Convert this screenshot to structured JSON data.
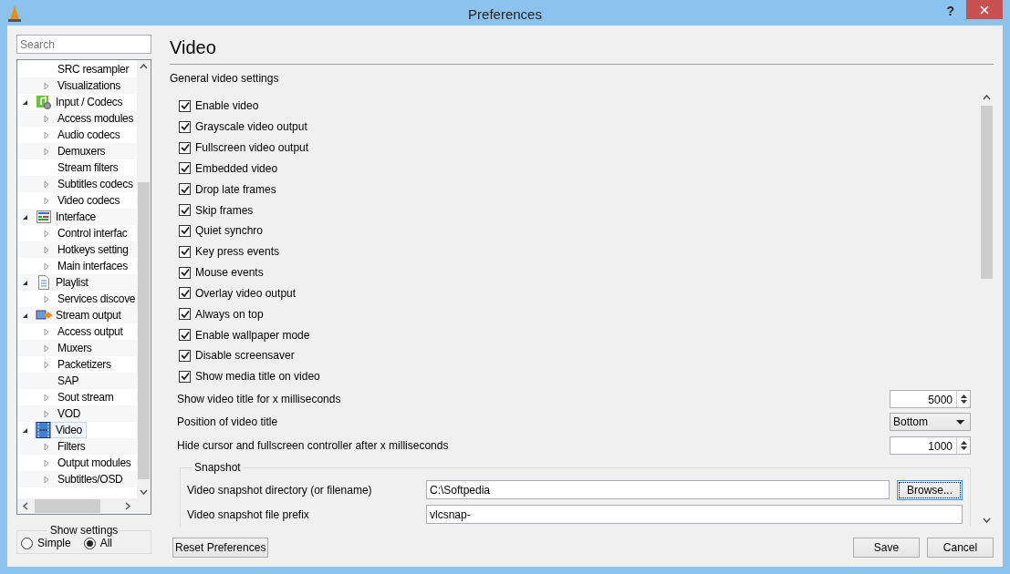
{
  "window": {
    "title": "Preferences",
    "help": "?"
  },
  "search": {
    "placeholder": "Search"
  },
  "tree": [
    {
      "children": [
        {
          "label": "SRC resampler",
          "selected": false
        },
        {
          "label": "Visualizations",
          "selected": false,
          "expanded": false
        }
      ]
    },
    {
      "label": "Input / Codecs",
      "kind": "codecs",
      "selected": false,
      "expanded": true,
      "children": [
        {
          "label": "Access modules",
          "selected": false,
          "expanded": false
        },
        {
          "label": "Audio codecs",
          "selected": false,
          "expanded": false
        },
        {
          "label": "Demuxers",
          "selected": false,
          "expanded": false
        },
        {
          "label": "Stream filters",
          "selected": false
        },
        {
          "label": "Subtitles codecs",
          "selected": false,
          "expanded": false
        },
        {
          "label": "Video codecs",
          "selected": false,
          "expanded": false
        }
      ]
    },
    {
      "label": "Interface",
      "kind": "interface",
      "selected": false,
      "expanded": true,
      "children": [
        {
          "label": "Control interfac",
          "selected": false,
          "expanded": false
        },
        {
          "label": "Hotkeys setting",
          "selected": false,
          "expanded": false
        },
        {
          "label": "Main interfaces",
          "selected": false,
          "expanded": false
        }
      ]
    },
    {
      "label": "Playlist",
      "kind": "playlist",
      "selected": false,
      "expanded": true,
      "children": [
        {
          "label": "Services discove",
          "selected": false,
          "expanded": false
        }
      ]
    },
    {
      "label": "Stream output",
      "kind": "stream",
      "selected": false,
      "expanded": true,
      "children": [
        {
          "label": "Access output",
          "selected": false,
          "expanded": false
        },
        {
          "label": "Muxers",
          "selected": false,
          "expanded": false
        },
        {
          "label": "Packetizers",
          "selected": false,
          "expanded": false
        },
        {
          "label": "SAP",
          "selected": false
        },
        {
          "label": "Sout stream",
          "selected": false,
          "expanded": false
        },
        {
          "label": "VOD",
          "selected": false,
          "expanded": false
        }
      ]
    },
    {
      "label": "Video",
      "kind": "video",
      "selected": true,
      "expanded": true,
      "children": [
        {
          "label": "Filters",
          "selected": false,
          "expanded": false
        },
        {
          "label": "Output modules",
          "selected": false,
          "expanded": false
        },
        {
          "label": "Subtitles/OSD",
          "selected": false,
          "expanded": false
        }
      ]
    }
  ],
  "show_settings": {
    "title": "Show settings",
    "options": [
      {
        "label": "Simple",
        "selected": false
      },
      {
        "label": "All",
        "selected": true
      }
    ]
  },
  "panel": {
    "title": "Video",
    "subtitle": "General video settings",
    "checkboxes": [
      {
        "label": "Enable video",
        "checked": true
      },
      {
        "label": "Grayscale video output",
        "checked": true
      },
      {
        "label": "Fullscreen video output",
        "checked": true
      },
      {
        "label": "Embedded video",
        "checked": true
      },
      {
        "label": "Drop late frames",
        "checked": true
      },
      {
        "label": "Skip frames",
        "checked": true
      },
      {
        "label": "Quiet synchro",
        "checked": true
      },
      {
        "label": "Key press events",
        "checked": true
      },
      {
        "label": "Mouse events",
        "checked": true
      },
      {
        "label": "Overlay video output",
        "checked": true
      },
      {
        "label": "Always on top",
        "checked": true
      },
      {
        "label": "Enable wallpaper mode",
        "checked": true
      },
      {
        "label": "Disable screensaver",
        "checked": true
      },
      {
        "label": "Show media title on video",
        "checked": true
      }
    ],
    "settings": [
      {
        "label": "Show video title for x milliseconds",
        "kind": "spin",
        "value": "5000"
      },
      {
        "label": "Position of video title",
        "kind": "select",
        "value": "Bottom"
      },
      {
        "label": "Hide cursor and fullscreen controller after x milliseconds",
        "kind": "spin",
        "value": "1000"
      }
    ],
    "snapshot": {
      "title": "Snapshot",
      "rows": [
        {
          "label": "Video snapshot directory (or filename)",
          "value": "C:\\Softpedia",
          "button": "Browse..."
        },
        {
          "label": "Video snapshot file prefix",
          "value": "vlcsnap-"
        }
      ]
    }
  },
  "buttons": {
    "reset": "Reset Preferences",
    "save": "Save",
    "cancel": "Cancel"
  }
}
